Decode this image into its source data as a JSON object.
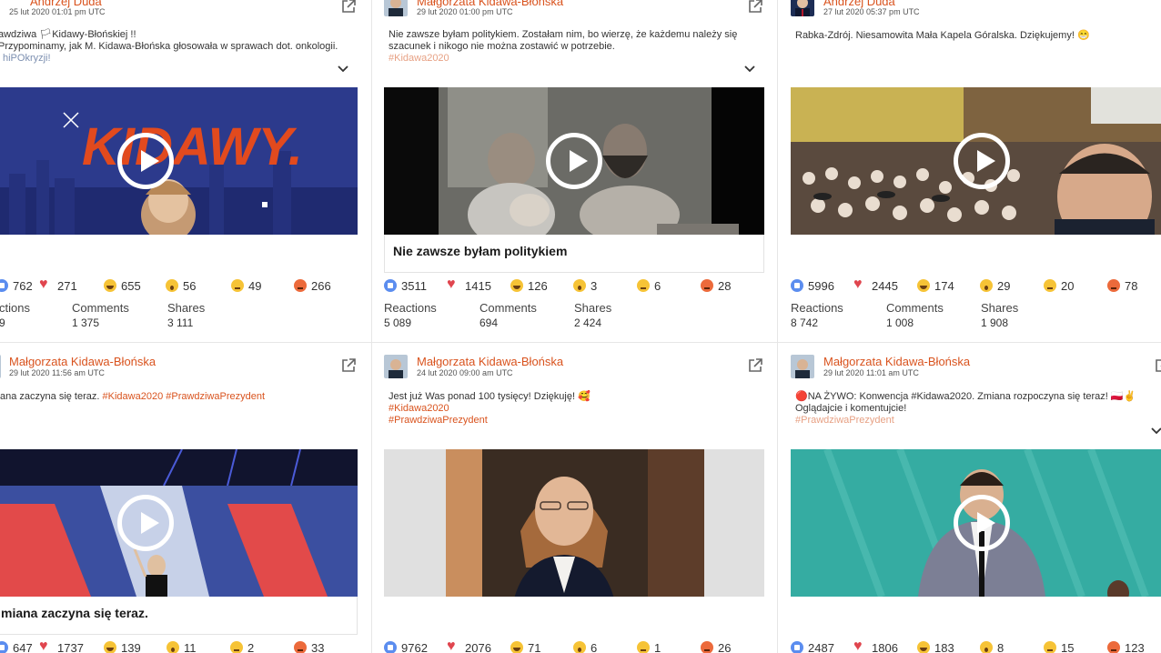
{
  "cards": [
    {
      "author": "Andrzej Duda",
      "date": "25 lut 2020 01:01 pm UTC",
      "text_lines": [
        "awdziwa 🏳Kidawy-Błońskiej !!",
        "Przypominamy, jak M. Kidawa-Błońska głosowała w sprawach dot. onkologii.",
        "hiPOkryzji!"
      ],
      "hashtags": [],
      "title": "",
      "reactions": {
        "like": "762",
        "love": "271",
        "haha": "655",
        "wow": "56",
        "sad": "49",
        "angry": "266"
      },
      "stats": {
        "reactions_label": "ctions",
        "reactions": "9",
        "comments_label": "Comments",
        "comments": "1 375",
        "shares_label": "Shares",
        "shares": "3 111"
      },
      "media_overlay_text": "KIDAWY."
    },
    {
      "author": "Małgorzata Kidawa-Błońska",
      "date": "29 lut 2020 01:00 pm UTC",
      "text_lines": [
        "Nie zawsze byłam politykiem. Zostałam nim, bo wierzę, że każdemu należy się",
        "szacunek i nikogo nie można zostawić w potrzebie."
      ],
      "hashtags": [
        "#Kidawa2020"
      ],
      "title": "Nie zawsze byłam politykiem",
      "reactions": {
        "like": "3511",
        "love": "1415",
        "haha": "126",
        "wow": "3",
        "sad": "6",
        "angry": "28"
      },
      "stats": {
        "reactions_label": "Reactions",
        "reactions": "5 089",
        "comments_label": "Comments",
        "comments": "694",
        "shares_label": "Shares",
        "shares": "2 424"
      }
    },
    {
      "author": "Andrzej Duda",
      "date": "27 lut 2020 05:37 pm UTC",
      "text_lines": [
        "Rabka-Zdrój. Niesamowita Mała Kapela Góralska. Dziękujemy! 😁"
      ],
      "hashtags": [],
      "title": "",
      "reactions": {
        "like": "5996",
        "love": "2445",
        "haha": "174",
        "wow": "29",
        "sad": "20",
        "angry": "78"
      },
      "stats": {
        "reactions_label": "Reactions",
        "reactions": "8 742",
        "comments_label": "Comments",
        "comments": "1 008",
        "shares_label": "Shares",
        "shares": "1 908"
      }
    },
    {
      "author": "Małgorzata Kidawa-Błońska",
      "date": "29 lut 2020 11:56 am UTC",
      "text_lines": [
        "ana zaczyna się teraz."
      ],
      "hashtags": [
        "#Kidawa2020",
        "#PrawdziwaPrezydent"
      ],
      "title": "miana zaczyna się teraz.",
      "reactions": {
        "like": "647",
        "love": "1737",
        "haha": "139",
        "wow": "11",
        "sad": "2",
        "angry": "33"
      },
      "stats": {}
    },
    {
      "author": "Małgorzata Kidawa-Błońska",
      "date": "24 lut 2020 09:00 am UTC",
      "text_lines": [
        "Jest już Was ponad 100 tysięcy! Dziękuję! 🥰"
      ],
      "hashtags": [
        "#Kidawa2020",
        "#PrawdziwaPrezydent"
      ],
      "title": "",
      "reactions": {
        "like": "9762",
        "love": "2076",
        "haha": "71",
        "wow": "6",
        "sad": "1",
        "angry": "26"
      },
      "stats": {}
    },
    {
      "author": "Małgorzata Kidawa-Błońska",
      "date": "29 lut 2020 11:01 am UTC",
      "text_lines": [
        "🔴NA ŻYWO: Konwencja #Kidawa2020. Zmiana rozpoczyna się teraz! 🇵🇱✌",
        "Oglądajcie i komentujcie!"
      ],
      "hashtags": [
        "#PrawdziwaPrezydent"
      ],
      "title": "",
      "reactions": {
        "like": "2487",
        "love": "1806",
        "haha": "183",
        "wow": "8",
        "sad": "15",
        "angry": "123"
      },
      "stats": {}
    }
  ],
  "colors": {
    "accent": "#d9531e",
    "like": "#5b8def",
    "love": "#e0454e"
  }
}
